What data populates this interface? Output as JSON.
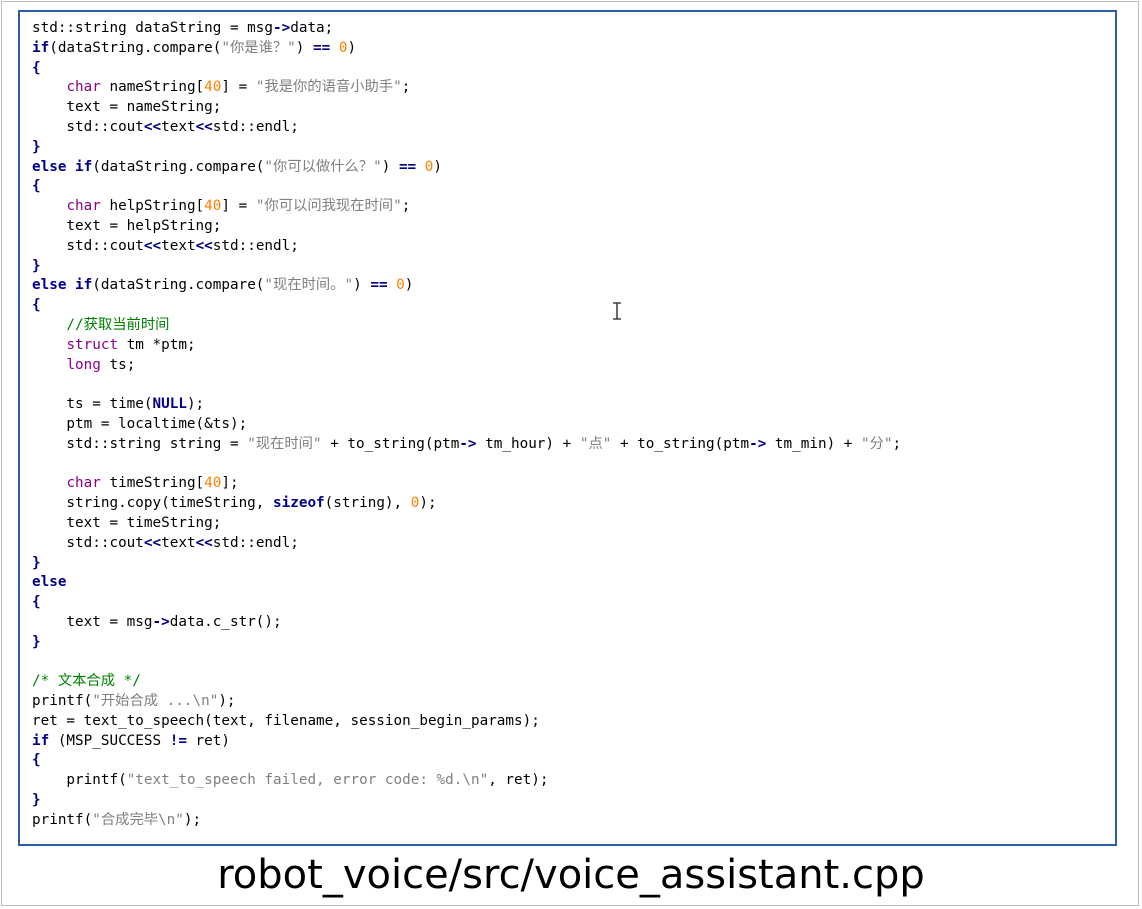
{
  "caption": "robot_voice/src/voice_assistant.cpp",
  "code_lines": [
    [
      {
        "t": "std::string dataString = msg",
        "c": ""
      },
      {
        "t": "->",
        "c": "op"
      },
      {
        "t": "data;",
        "c": ""
      }
    ],
    [
      {
        "t": "if",
        "c": "kw"
      },
      {
        "t": "(dataString.compare(",
        "c": ""
      },
      {
        "t": "\"你是谁？\"",
        "c": "str"
      },
      {
        "t": ") ",
        "c": ""
      },
      {
        "t": "==",
        "c": "op"
      },
      {
        "t": " ",
        "c": ""
      },
      {
        "t": "0",
        "c": "num"
      },
      {
        "t": ")",
        "c": ""
      }
    ],
    [
      {
        "t": "{",
        "c": "op"
      }
    ],
    [
      {
        "t": "    ",
        "c": ""
      },
      {
        "t": "char",
        "c": "ty"
      },
      {
        "t": " nameString[",
        "c": ""
      },
      {
        "t": "40",
        "c": "num"
      },
      {
        "t": "] = ",
        "c": ""
      },
      {
        "t": "\"我是你的语音小助手\"",
        "c": "str"
      },
      {
        "t": ";",
        "c": ""
      }
    ],
    [
      {
        "t": "    text = nameString;",
        "c": ""
      }
    ],
    [
      {
        "t": "    std::cout",
        "c": ""
      },
      {
        "t": "<<",
        "c": "op"
      },
      {
        "t": "text",
        "c": ""
      },
      {
        "t": "<<",
        "c": "op"
      },
      {
        "t": "std::endl;",
        "c": ""
      }
    ],
    [
      {
        "t": "}",
        "c": "op"
      }
    ],
    [
      {
        "t": "else",
        "c": "kw"
      },
      {
        "t": " ",
        "c": ""
      },
      {
        "t": "if",
        "c": "kw"
      },
      {
        "t": "(dataString.compare(",
        "c": ""
      },
      {
        "t": "\"你可以做什么？\"",
        "c": "str"
      },
      {
        "t": ") ",
        "c": ""
      },
      {
        "t": "==",
        "c": "op"
      },
      {
        "t": " ",
        "c": ""
      },
      {
        "t": "0",
        "c": "num"
      },
      {
        "t": ")",
        "c": ""
      }
    ],
    [
      {
        "t": "{",
        "c": "op"
      }
    ],
    [
      {
        "t": "    ",
        "c": ""
      },
      {
        "t": "char",
        "c": "ty"
      },
      {
        "t": " helpString[",
        "c": ""
      },
      {
        "t": "40",
        "c": "num"
      },
      {
        "t": "] = ",
        "c": ""
      },
      {
        "t": "\"你可以问我现在时间\"",
        "c": "str"
      },
      {
        "t": ";",
        "c": ""
      }
    ],
    [
      {
        "t": "    text = helpString;",
        "c": ""
      }
    ],
    [
      {
        "t": "    std::cout",
        "c": ""
      },
      {
        "t": "<<",
        "c": "op"
      },
      {
        "t": "text",
        "c": ""
      },
      {
        "t": "<<",
        "c": "op"
      },
      {
        "t": "std::endl;",
        "c": ""
      }
    ],
    [
      {
        "t": "}",
        "c": "op"
      }
    ],
    [
      {
        "t": "else",
        "c": "kw"
      },
      {
        "t": " ",
        "c": ""
      },
      {
        "t": "if",
        "c": "kw"
      },
      {
        "t": "(dataString.compare(",
        "c": ""
      },
      {
        "t": "\"现在时间。\"",
        "c": "str"
      },
      {
        "t": ") ",
        "c": ""
      },
      {
        "t": "==",
        "c": "op"
      },
      {
        "t": " ",
        "c": ""
      },
      {
        "t": "0",
        "c": "num"
      },
      {
        "t": ")",
        "c": ""
      }
    ],
    [
      {
        "t": "{",
        "c": "op"
      }
    ],
    [
      {
        "t": "    //获取当前时间",
        "c": "cm"
      }
    ],
    [
      {
        "t": "    ",
        "c": ""
      },
      {
        "t": "struct",
        "c": "ty"
      },
      {
        "t": " tm *ptm;",
        "c": ""
      }
    ],
    [
      {
        "t": "    ",
        "c": ""
      },
      {
        "t": "long",
        "c": "ty"
      },
      {
        "t": " ts;",
        "c": ""
      }
    ],
    [
      {
        "t": "",
        "c": ""
      }
    ],
    [
      {
        "t": "    ts = time(",
        "c": ""
      },
      {
        "t": "NULL",
        "c": "kw"
      },
      {
        "t": ");",
        "c": ""
      }
    ],
    [
      {
        "t": "    ptm = localtime(&ts);",
        "c": ""
      }
    ],
    [
      {
        "t": "    std::string string = ",
        "c": ""
      },
      {
        "t": "\"现在时间\"",
        "c": "str"
      },
      {
        "t": " + to_string(ptm",
        "c": ""
      },
      {
        "t": "->",
        "c": "op"
      },
      {
        "t": " tm_hour) + ",
        "c": ""
      },
      {
        "t": "\"点\"",
        "c": "str"
      },
      {
        "t": " + to_string(ptm",
        "c": ""
      },
      {
        "t": "->",
        "c": "op"
      },
      {
        "t": " tm_min) + ",
        "c": ""
      },
      {
        "t": "\"分\"",
        "c": "str"
      },
      {
        "t": ";",
        "c": ""
      }
    ],
    [
      {
        "t": "",
        "c": ""
      }
    ],
    [
      {
        "t": "    ",
        "c": ""
      },
      {
        "t": "char",
        "c": "ty"
      },
      {
        "t": " timeString[",
        "c": ""
      },
      {
        "t": "40",
        "c": "num"
      },
      {
        "t": "];",
        "c": ""
      }
    ],
    [
      {
        "t": "    string.copy(timeString, ",
        "c": ""
      },
      {
        "t": "sizeof",
        "c": "kw"
      },
      {
        "t": "(string), ",
        "c": ""
      },
      {
        "t": "0",
        "c": "num"
      },
      {
        "t": ");",
        "c": ""
      }
    ],
    [
      {
        "t": "    text = timeString;",
        "c": ""
      }
    ],
    [
      {
        "t": "    std::cout",
        "c": ""
      },
      {
        "t": "<<",
        "c": "op"
      },
      {
        "t": "text",
        "c": ""
      },
      {
        "t": "<<",
        "c": "op"
      },
      {
        "t": "std::endl;",
        "c": ""
      }
    ],
    [
      {
        "t": "}",
        "c": "op"
      }
    ],
    [
      {
        "t": "else",
        "c": "kw"
      }
    ],
    [
      {
        "t": "{",
        "c": "op"
      }
    ],
    [
      {
        "t": "    text = msg",
        "c": ""
      },
      {
        "t": "->",
        "c": "op"
      },
      {
        "t": "data.c_str();",
        "c": ""
      }
    ],
    [
      {
        "t": "}",
        "c": "op"
      }
    ],
    [
      {
        "t": "",
        "c": ""
      }
    ],
    [
      {
        "t": "/* 文本合成 */",
        "c": "cm"
      }
    ],
    [
      {
        "t": "printf(",
        "c": ""
      },
      {
        "t": "\"开始合成 ...\\n\"",
        "c": "str"
      },
      {
        "t": ");",
        "c": ""
      }
    ],
    [
      {
        "t": "ret = text_to_speech(text, filename, session_begin_params);",
        "c": ""
      }
    ],
    [
      {
        "t": "if",
        "c": "kw"
      },
      {
        "t": " (MSP_SUCCESS ",
        "c": ""
      },
      {
        "t": "!=",
        "c": "op"
      },
      {
        "t": " ret)",
        "c": ""
      }
    ],
    [
      {
        "t": "{",
        "c": "op"
      }
    ],
    [
      {
        "t": "    printf(",
        "c": ""
      },
      {
        "t": "\"text_to_speech failed, error code: %d.\\n\"",
        "c": "str"
      },
      {
        "t": ", ret);",
        "c": ""
      }
    ],
    [
      {
        "t": "}",
        "c": "op"
      }
    ],
    [
      {
        "t": "printf(",
        "c": ""
      },
      {
        "t": "\"合成完毕\\n\"",
        "c": "str"
      },
      {
        "t": ");",
        "c": ""
      }
    ]
  ]
}
